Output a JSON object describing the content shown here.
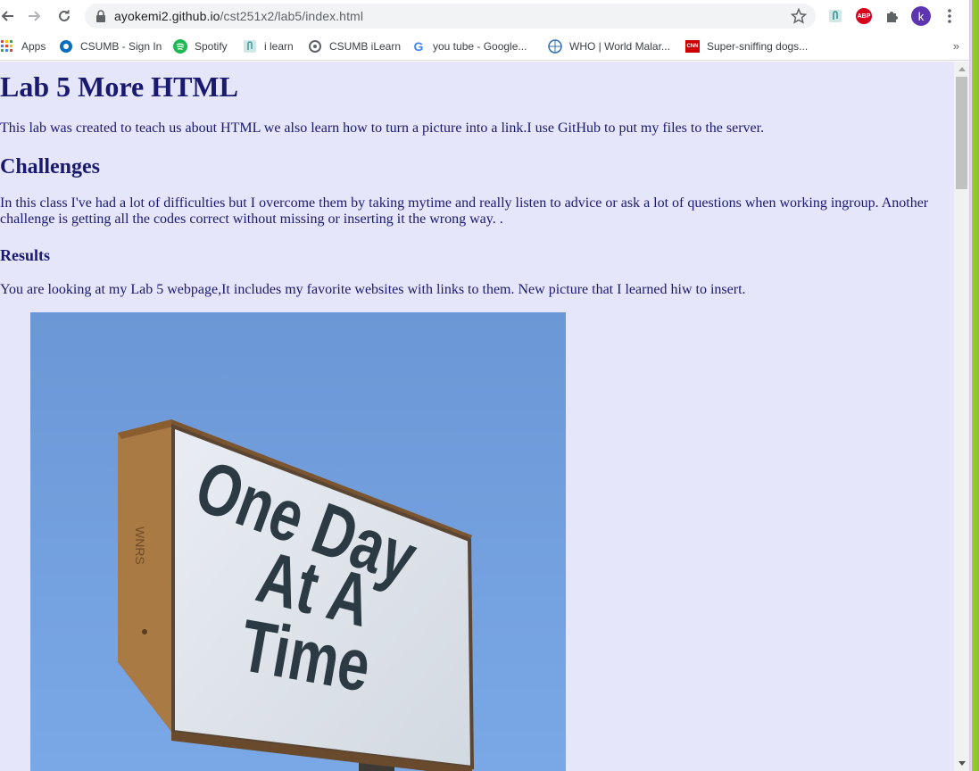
{
  "browser": {
    "url_host": "ayokemi2.github.io",
    "url_path": "/cst251x2/lab5/index.html",
    "profile_initial": "k",
    "abp_label": "ABP",
    "bookmarks": [
      {
        "label": "Apps",
        "icon": "apps-grid-icon"
      },
      {
        "label": "CSUMB - Sign In",
        "icon": "csumb-icon"
      },
      {
        "label": "Spotify",
        "icon": "spotify-icon"
      },
      {
        "label": "i learn",
        "icon": "ilearn-icon"
      },
      {
        "label": "CSUMB iLearn",
        "icon": "csumb-ilearn-icon"
      },
      {
        "label": "you tube - Google...",
        "icon": "google-icon"
      },
      {
        "label": "WHO | World Malar...",
        "icon": "who-icon"
      },
      {
        "label": "Super-sniffing dogs...",
        "icon": "cnn-icon"
      }
    ],
    "cnn_label": "CNN",
    "more_bookmarks": "»"
  },
  "page": {
    "title": "Lab 5 More HTML",
    "intro": "This lab was created to teach us about HTML we also learn how to turn a picture into a link.I use GitHub to put my files to the server.",
    "challenges_heading": "Challenges",
    "challenges_text": "In this class I've had a lot of difficulties but I overcome them by taking mytime and really listen to advice or ask a lot of questions when working ingroup. Another challenge is getting all the codes correct without missing or inserting it the wrong way. .",
    "results_heading": "Results",
    "results_text": "You are looking at my Lab 5 webpage,It includes my favorite websites with links to them. New picture that I learned hiw to insert.",
    "photo": {
      "sign_line1": "One Day",
      "sign_line2": "At A",
      "sign_line3": "Time",
      "post_label": "WNRS"
    }
  },
  "colors": {
    "page_bg": "#e6e6fa",
    "text": "#191970",
    "sky": "#6f9ede",
    "sign_text": "#2c3a44"
  }
}
